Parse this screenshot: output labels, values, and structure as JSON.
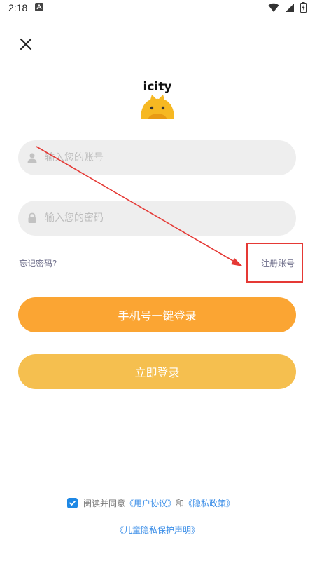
{
  "status_bar": {
    "time": "2:18"
  },
  "app": {
    "name": "icity"
  },
  "form": {
    "account_placeholder": "输入您的账号",
    "password_placeholder": "输入您的密码",
    "forgot_label": "忘记密码?",
    "register_label": "注册账号"
  },
  "buttons": {
    "phone_login": "手机号一键登录",
    "login": "立即登录"
  },
  "agreement": {
    "prefix": "阅读并同意",
    "user_agreement": "《用户协议》",
    "and": "和",
    "privacy_policy": "《隐私政策》",
    "child_privacy": "《儿童隐私保护声明》",
    "checked": true
  },
  "colors": {
    "primary_button": "#fba533",
    "secondary_button": "#f5bf4f",
    "link": "#3d8fe8",
    "annotation": "#e53935"
  }
}
